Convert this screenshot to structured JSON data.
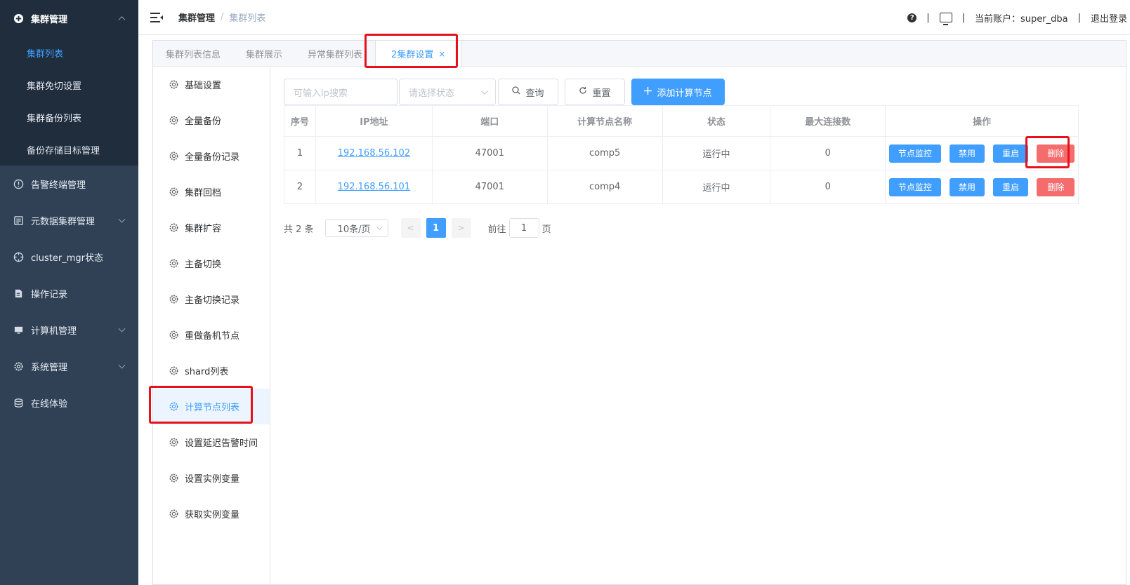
{
  "sidebar": {
    "items": [
      {
        "label": "集群管理",
        "icon": "plus-circle-icon",
        "expanded": true,
        "children": [
          {
            "label": "集群列表",
            "active": true
          },
          {
            "label": "集群免切设置"
          },
          {
            "label": "集群备份列表"
          },
          {
            "label": "备份存储目标管理"
          }
        ]
      },
      {
        "label": "告警终端管理",
        "icon": "alert-circle-icon"
      },
      {
        "label": "元数据集群管理",
        "icon": "database-box-icon"
      },
      {
        "label": "cluster_mgr状态",
        "icon": "crosshair-icon"
      },
      {
        "label": "操作记录",
        "icon": "edit-doc-icon"
      },
      {
        "label": "计算机管理",
        "icon": "monitor-icon"
      },
      {
        "label": "系统管理",
        "icon": "gear-icon"
      },
      {
        "label": "在线体验",
        "icon": "database-icon"
      }
    ]
  },
  "header": {
    "breadcrumb": [
      "集群管理",
      "集群列表"
    ],
    "breadcrumb_sep": "/",
    "help_glyph": "?",
    "separator": "|",
    "account": "当前账户：super_dba",
    "logout": "退出登录"
  },
  "tabs": [
    {
      "label": "集群列表信息"
    },
    {
      "label": "集群展示"
    },
    {
      "label": "异常集群列表"
    },
    {
      "label": "2集群设置",
      "active": true,
      "close": "×"
    }
  ],
  "settings_menu": [
    {
      "label": "基础设置"
    },
    {
      "label": "全量备份"
    },
    {
      "label": "全量备份记录"
    },
    {
      "label": "集群回档"
    },
    {
      "label": "集群扩容"
    },
    {
      "label": "主备切换"
    },
    {
      "label": "主备切换记录"
    },
    {
      "label": "重做备机节点"
    },
    {
      "label": "shard列表"
    },
    {
      "label": "计算节点列表",
      "active": true
    },
    {
      "label": "设置延迟告警时间"
    },
    {
      "label": "设置实例变量"
    },
    {
      "label": "获取实例变量"
    }
  ],
  "toolbar": {
    "ip_placeholder": "可输入ip搜索",
    "status_placeholder": "请选择状态",
    "query_label": "查询",
    "reset_label": "重置",
    "add_label": "添加计算节点"
  },
  "table": {
    "columns": [
      "序号",
      "IP地址",
      "端口",
      "计算节点名称",
      "状态",
      "最大连接数",
      "操作"
    ],
    "rows": [
      {
        "index": "1",
        "ip": "192.168.56.102",
        "port": "47001",
        "name": "comp5",
        "status": "运行中",
        "max_conn": "0"
      },
      {
        "index": "2",
        "ip": "192.168.56.101",
        "port": "47001",
        "name": "comp4",
        "status": "运行中",
        "max_conn": "0"
      }
    ],
    "actions": {
      "monitor": "节点监控",
      "disable": "禁用",
      "restart": "重启",
      "delete": "删除"
    }
  },
  "pagination": {
    "total": "共 2 条",
    "page_size": "10条/页",
    "prev": "<",
    "current_page": "1",
    "next": ">",
    "goto_label": "前往",
    "goto_value": "1",
    "page_unit": "页"
  },
  "colors": {
    "sidebar_bg": "#304156",
    "submenu_bg": "#1f2d3d",
    "primary": "#409eff",
    "danger": "#f56c6c",
    "success": "#67c23a",
    "highlight": "#e5121c"
  }
}
